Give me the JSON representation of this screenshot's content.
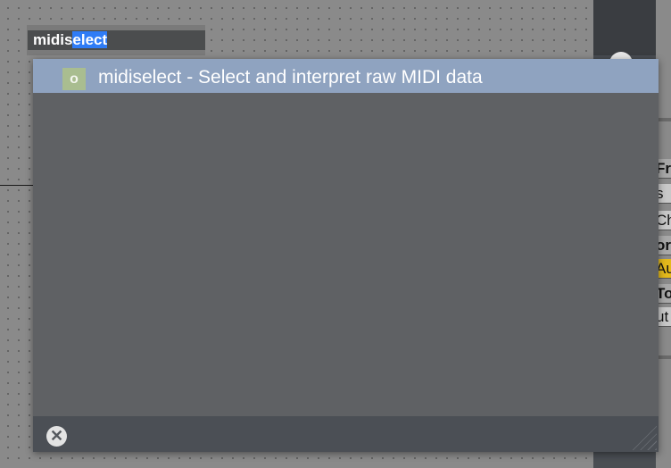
{
  "object_box": {
    "text_prefix": "midis",
    "text_selected": "elect"
  },
  "popup": {
    "items": [
      {
        "badge": "o",
        "label": "midiselect - Select and interpret raw MIDI data"
      }
    ],
    "close_glyph": "✕"
  },
  "inspector": {
    "cells": [
      "Fro",
      "s",
      "Ch",
      "or",
      "Au",
      "To",
      "ut"
    ]
  },
  "colors": {
    "selection": "#2f7cf6",
    "highlight_row": "#8fa3c0",
    "badge": "#a9bd90",
    "popup_bg": "#5f6164",
    "footer_bg": "#4b4f55",
    "inspector_yellow": "#e3b91c"
  },
  "icons": {
    "close": "close-circle-icon",
    "info": "info-icon",
    "resize": "resize-grip-icon"
  }
}
